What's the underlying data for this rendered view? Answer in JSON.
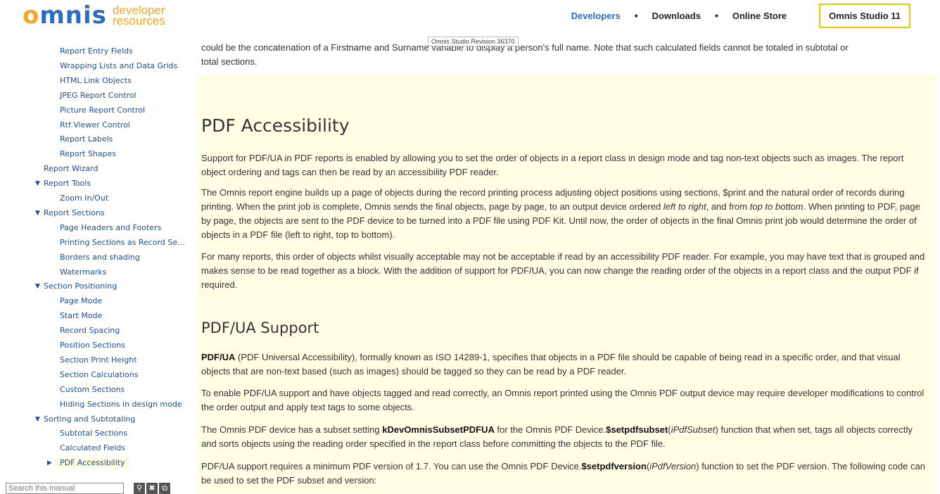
{
  "header": {
    "logo_word": "omnis",
    "logo_sub_1": "developer",
    "logo_sub_2": "resources",
    "nav": [
      {
        "label": "Developers",
        "active": true
      },
      {
        "label": "Downloads",
        "active": false
      },
      {
        "label": "Online Store",
        "active": false
      }
    ],
    "nav_separator": "•",
    "studio_button": "Omnis Studio 11",
    "revision_tooltip": "Omnis Studio Revision 36370"
  },
  "sidebar": {
    "items": [
      {
        "label": "Report Entry Fields",
        "level": 2
      },
      {
        "label": "Wrapping Lists and Data Grids",
        "level": 2
      },
      {
        "label": "HTML Link Objects",
        "level": 2
      },
      {
        "label": "JPEG Report Control",
        "level": 2
      },
      {
        "label": "Picture Report Control",
        "level": 2
      },
      {
        "label": "Rtf Viewer Control",
        "level": 2
      },
      {
        "label": "Report Labels",
        "level": 2
      },
      {
        "label": "Report Shapes",
        "level": 2
      },
      {
        "label": "Report Wizard",
        "level": 1
      },
      {
        "label": "Report Tools",
        "level": 1,
        "arrow": "▼"
      },
      {
        "label": "Zoom In/Out",
        "level": 2
      },
      {
        "label": "Report Sections",
        "level": 1,
        "arrow": "▼"
      },
      {
        "label": "Page Headers and Footers",
        "level": 2
      },
      {
        "label": "Printing Sections as Record Se...",
        "level": 2
      },
      {
        "label": "Borders and shading",
        "level": 2
      },
      {
        "label": "Watermarks",
        "level": 2
      },
      {
        "label": "Section Positioning",
        "level": 1,
        "arrow": "▼"
      },
      {
        "label": "Page Mode",
        "level": 2
      },
      {
        "label": "Start Mode",
        "level": 2
      },
      {
        "label": "Record Spacing",
        "level": 2
      },
      {
        "label": "Position Sections",
        "level": 2
      },
      {
        "label": "Section Print Height",
        "level": 2
      },
      {
        "label": "Section Calculations",
        "level": 2
      },
      {
        "label": "Custom Sections",
        "level": 2
      },
      {
        "label": "Hiding Sections in design mode",
        "level": 2
      },
      {
        "label": "Sorting and Subtotaling",
        "level": 1,
        "arrow": "▼"
      },
      {
        "label": "Subtotal Sections",
        "level": 2
      },
      {
        "label": "Calculated Fields",
        "level": 2
      },
      {
        "label": "PDF Accessibility",
        "level": 2,
        "arrow": "▶",
        "active": true
      }
    ],
    "search_placeholder": "Search this manual"
  },
  "content": {
    "intro_1": "could be the concatenation of a Firstname and Surname variable to display a person's full name. Note that such calculated fields cannot be totaled in subtotal or",
    "intro_2": "total sections.",
    "heading_pdf_accessibility": "PDF Accessibility",
    "p1": "Support for PDF/UA in PDF reports is enabled by allowing you to set the order of objects in a report class in design mode and tag non-text objects such as images. The report object ordering and tags can then be read by an accessibility PDF reader.",
    "p2_a": "The Omnis report engine builds up a page of objects during the record printing process adjusting object positions using sections, $print and the natural order of records during printing. When the print job is complete, Omnis sends the final objects, page by page, to an output device ordered ",
    "p2_em1": "left to right",
    "p2_b": ", and from ",
    "p2_em2": "top to bottom",
    "p2_c": ". When printing to PDF, page by page, the objects are sent to the PDF device to be turned into a PDF file using PDF Kit. Until now, the order of objects in the final Omnis print job would determine the order of objects in a PDF file (left to right, top to bottom).",
    "p3": "For many reports, this order of objects whilst visually acceptable may not be acceptable if read by an accessibility PDF reader. For example, you may have text that is grouped and makes sense to be read together as a block. With the addition of support for PDF/UA, you can now change the reading order of the objects in a report class and the output PDF if required.",
    "heading_pdfua_support": "PDF/UA Support",
    "p4_bold": "PDF/UA",
    "p4_rest": " (PDF Universal Accessibility), formally known as ISO 14289-1, specifies that objects in a PDF file should be capable of being read in a specific order, and that visual objects that are non-text based (such as images) should be tagged so they can be read by a PDF reader.",
    "p5": "To enable PDF/UA support and have objects tagged and read correctly, an Omnis report printed using the Omnis PDF output device may require developer modifications to control the order output and apply text tags to some objects.",
    "p6_a": "The Omnis PDF device has a subset setting ",
    "p6_b1": "kDevOmnisSubsetPDFUA",
    "p6_c": " for the Omnis PDF Device.",
    "p6_b2": "$setpdfsubset",
    "p6_d": "(",
    "p6_em": "iPdfSubset",
    "p6_e": ") function that when set, tags all objects correctly and sorts objects using the reading order specified in the report class before committing the objects to the PDF file.",
    "p7_a": "PDF/UA support requires a minimum PDF version of 1.7. You can use the Omnis PDF Device.",
    "p7_b": "$setpdfversion",
    "p7_c": "(",
    "p7_em": "iPdfVersion",
    "p7_d": ") function to set the PDF version. The following code can be used to set the PDF subset and version:"
  }
}
